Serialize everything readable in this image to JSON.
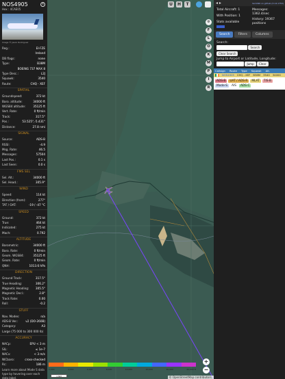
{
  "info": {
    "callsign": "NOS4905",
    "hex": "Hex : 4CAE05",
    "photo_credit": "Image © Jason Rodriguez",
    "general": [
      {
        "label": "Reg.:",
        "value": "EI-FZE"
      },
      {
        "label": "",
        "value": "Ireland"
      },
      {
        "label": "DB flags:",
        "value": "none"
      },
      {
        "label": "Type:",
        "value": "B38M"
      },
      {
        "label": "",
        "value": "BOEING 737 MAX 8"
      },
      {
        "label": "Type Desc.:",
        "value": "L2J"
      },
      {
        "label": "Squawk:",
        "value": "3540"
      },
      {
        "label": "Route:",
        "value": "CHQ - XEF"
      }
    ],
    "spatial_title": "SPATIAL",
    "spatial": [
      {
        "label": "Groundspeed:",
        "value": "372 kt"
      },
      {
        "label": "Baro. altitude:",
        "value": "34000 ft"
      },
      {
        "label": "WGS84 altitude:",
        "value": "35125 ft"
      },
      {
        "label": "Vert. Rate:",
        "value": "0 ft/min"
      },
      {
        "label": "Track:",
        "value": "317.5°"
      },
      {
        "label": "Pos.:",
        "value": "53.525°,-5.431°"
      },
      {
        "label": "Distance:",
        "value": "27.8 nmi"
      }
    ],
    "signal_title": "SIGNAL",
    "signal": [
      {
        "label": "Source:",
        "value": "ADS-B"
      },
      {
        "label": "RSSI:",
        "value": "-4.9"
      },
      {
        "label": "Msg. Rate:",
        "value": "46.5"
      },
      {
        "label": "Messages:",
        "value": "57504"
      },
      {
        "label": "Last Pos.:",
        "value": "0.1 s"
      },
      {
        "label": "Last Seen:",
        "value": "0.0 s"
      }
    ],
    "fms_title": "FMS SEL",
    "fms": [
      {
        "label": "Sel. Alt.:",
        "value": "34000 ft"
      },
      {
        "label": "Sel. Head.:",
        "value": "305.9°"
      }
    ],
    "wind_title": "WIND",
    "wind": [
      {
        "label": "Speed:",
        "value": "114 kt"
      },
      {
        "label": "Direction (from):",
        "value": "277°"
      },
      {
        "label": "TAT / OAT:",
        "value": "-19 / -47 °C"
      }
    ],
    "speed_title": "SPEED",
    "speed": [
      {
        "label": "Ground:",
        "value": "372 kt"
      },
      {
        "label": "True:",
        "value": "464 kt"
      },
      {
        "label": "Indicated:",
        "value": "275 kt"
      },
      {
        "label": "Mach:",
        "value": "0.792"
      }
    ],
    "altitude_title": "ALTITUDE",
    "altitude": [
      {
        "label": "Barometric:",
        "value": "34000 ft"
      },
      {
        "label": "Baro. Rate:",
        "value": "0 ft/min"
      },
      {
        "label": "Geom. WGS84:",
        "value": "35125 ft"
      },
      {
        "label": "Geom. Rate:",
        "value": "0 ft/min"
      },
      {
        "label": "QNH:",
        "value": "1013.6 hPa"
      }
    ],
    "direction_title": "DIRECTION",
    "direction": [
      {
        "label": "Ground Track:",
        "value": "317.5°"
      },
      {
        "label": "True Heading:",
        "value": "306.2°"
      },
      {
        "label": "Magnetic Heading:",
        "value": "305.5°"
      },
      {
        "label": "Magnetic Decl.:",
        "value": "2.8°"
      },
      {
        "label": "Track Rate:",
        "value": "0.00"
      },
      {
        "label": "Roll:",
        "value": "-0.2"
      }
    ],
    "stuff_title": "STUFF",
    "stuff": [
      {
        "label": "Nav. Modes:",
        "value": "n/a"
      },
      {
        "label": "ADS-B Ver.:",
        "value": "v2 (DO-260B)"
      },
      {
        "label": "Category:",
        "value": "A3"
      }
    ],
    "category_desc": "Large (75 000 to 300 000 lb)",
    "accuracy_title": "ACCURACY",
    "accuracy": [
      {
        "label": "NACp:",
        "value": "EPU < 3 m"
      },
      {
        "label": "SIL:",
        "value": "≤ 1e-7"
      },
      {
        "label": "NACv:",
        "value": "< 3 m/s"
      },
      {
        "label": "NICbaro:",
        "value": "cross-checked"
      },
      {
        "label": "Rc:",
        "value": "186 m"
      }
    ],
    "note": "Learn more about Mode S data type by hovering over each data label."
  },
  "map": {
    "buttons": [
      "U",
      "H",
      "T"
    ],
    "scale_label": "1 NM",
    "scale_ticks": [
      "2,000",
      "4,000",
      "6,000",
      "8,000",
      "10,000",
      "20,000",
      "30,000",
      "40,000 ft"
    ],
    "scale_colors": [
      "#ff6b1a",
      "#ffb300",
      "#e8e800",
      "#9be000",
      "#33cc33",
      "#00cc99",
      "#00aadd",
      "#4466ff",
      "#9933ff",
      "#cc33cc"
    ],
    "attribution": "© OpenStreetMap contributors.",
    "zoom_in": "+",
    "zoom_out": "−"
  },
  "side_buttons": [
    "F",
    "L",
    "O",
    "K",
    "M",
    "P",
    "I",
    "R"
  ],
  "panel": {
    "link_text": "tar1090 on github (3.14.1753)",
    "arrows": "◂ ▸",
    "total_aircraft": "Total Aircraft: 1",
    "with_position": "With Position: 1",
    "stats_label": "Stats available",
    "messages": "Messages: 1362.4/sec",
    "history": "History: 19367 positions",
    "tabs": [
      "Search",
      "Filters",
      "Columns"
    ],
    "search_label": "Search:",
    "search_button": "Search",
    "clear_search": "Clear Search",
    "jump_label": "Jump to Airport or Latitude, Longitude:",
    "jump_button": "Jump",
    "clear_button": "Clear",
    "table_headers": [
      "Callsign",
      "Route",
      "Type",
      "Squawk",
      "Alt."
    ],
    "table_rows": [
      {
        "flag": "IE",
        "callsign": "NOS4905",
        "route": "CHQ - XEF",
        "type": "B38M",
        "squawk": "3540",
        "alt": "34000"
      }
    ],
    "badges": [
      {
        "label": "ADS-B",
        "color": "#dd7b88"
      },
      {
        "label": "UAT / ADS-R",
        "color": "#e0b050"
      },
      {
        "label": "MLAT",
        "color": "#e6d37a"
      },
      {
        "label": "TIS-B",
        "color": "#e9a3a3"
      },
      {
        "label": "Mode-S",
        "color": "#c7d4f0"
      },
      {
        "label": "AIS",
        "color": "#ffffff"
      },
      {
        "label": "ADS-C",
        "color": "#a8e0a8"
      }
    ]
  }
}
